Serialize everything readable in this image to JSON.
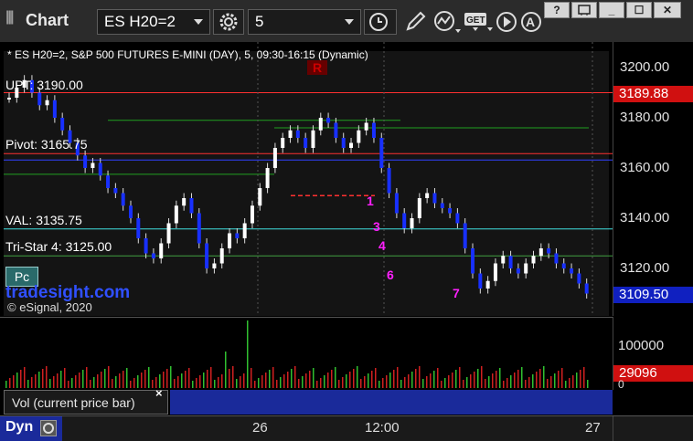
{
  "window": {
    "title": "Chart",
    "symbol": "ES H20=2",
    "interval": "5",
    "buttons": {
      "help": "?",
      "minimize": "_",
      "maximize": "☐",
      "close": "✕"
    }
  },
  "chart": {
    "description": "* ES H20=2, S&P 500 FUTURES E-MINI (DAY), 5, 09:30-16:15 (Dynamic)",
    "copyright": "© eSignal, 2020",
    "watermark": "tradesight.com",
    "pc_badge": "Pc",
    "r_marker": "R",
    "levels": [
      {
        "name": "upt",
        "label": "UPT: 3190.00",
        "price": 3190.0,
        "color": "#ff3030"
      },
      {
        "name": "pivot",
        "label": "Pivot: 3165.75",
        "price": 3165.75,
        "color": "#ff3030"
      },
      {
        "name": "val",
        "label": "VAL: 3135.75",
        "price": 3135.75,
        "color": "#40e0e0"
      },
      {
        "name": "tristar",
        "label": "Tri-Star 4: 3125.00",
        "price": 3125.0,
        "color": "#40a040"
      }
    ],
    "price_axis": {
      "ticks": [
        "3200.00",
        "3180.00",
        "3160.00",
        "3140.00",
        "3120.00"
      ],
      "badges": [
        {
          "value": "3189.88",
          "color": "#d01010"
        },
        {
          "value": "3109.50",
          "color": "#1020c0"
        }
      ]
    },
    "time_axis": [
      "26",
      "12:00",
      "27"
    ],
    "seq_labels": [
      "1",
      "3",
      "4",
      "6",
      "7"
    ]
  },
  "volume": {
    "label": "Vol (current price bar)",
    "tick": "100000",
    "zero": "0",
    "badge": "29096",
    "badge_color": "#d01010"
  },
  "footer": {
    "tab": "Dyn"
  }
}
